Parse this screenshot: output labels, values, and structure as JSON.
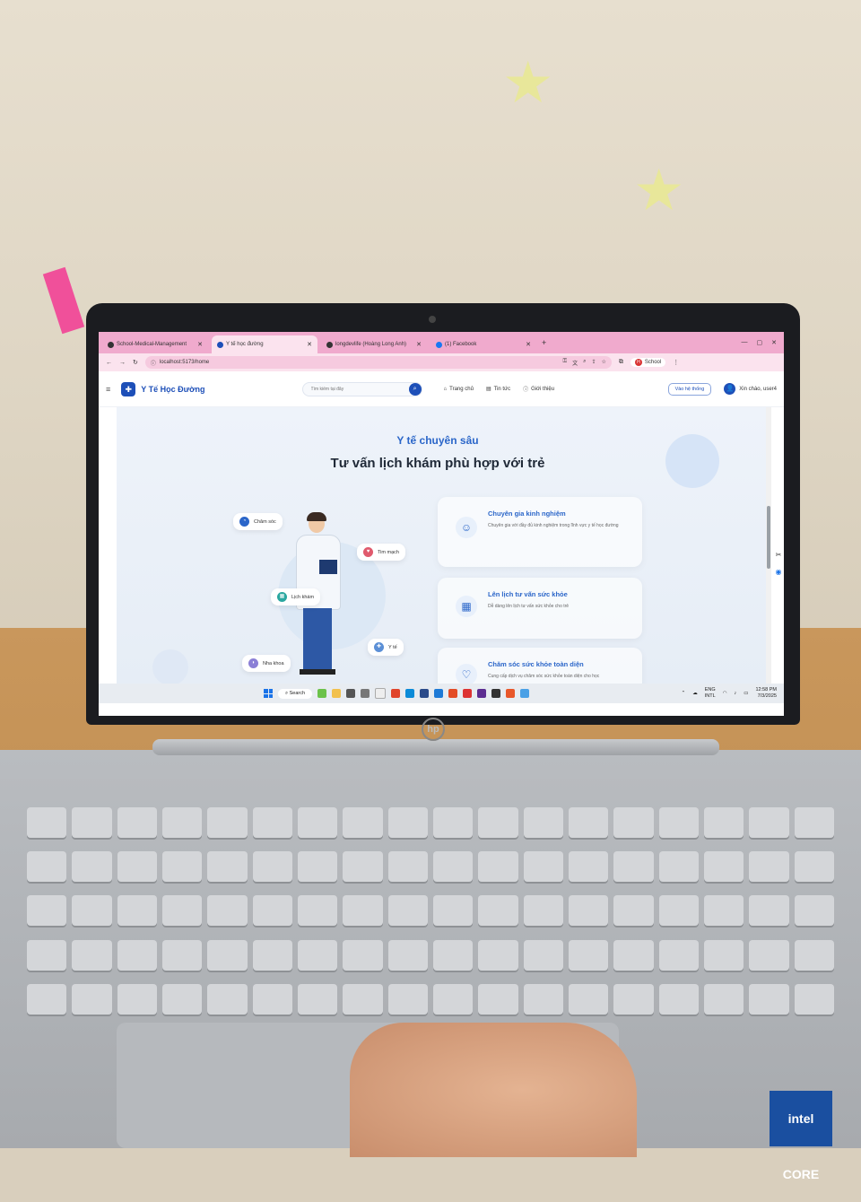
{
  "browser": {
    "tabs": [
      {
        "label": "School-Medical-Management",
        "icon": "github-icon",
        "active": false
      },
      {
        "label": "Y tế học đường",
        "icon": "site-icon",
        "active": true
      },
      {
        "label": "longdevlife (Hoàng Long Anh)",
        "icon": "github-icon",
        "active": false
      },
      {
        "label": "(1) Facebook",
        "icon": "facebook-icon",
        "active": false
      }
    ],
    "new_tab": "+",
    "url": "localhost:5173/home",
    "profile_initial": "H",
    "profile_label": "School"
  },
  "site": {
    "brand": "Y Tế Học Đường",
    "search_placeholder": "Tìm kiếm tại đây",
    "nav": [
      "Trang chủ",
      "Tin tức",
      "Giới thiệu"
    ],
    "system_button": "Vào hệ thống",
    "greeting": "Xin chào, user4"
  },
  "hero": {
    "kicker": "Y tế chuyên sâu",
    "headline": "Tư vấn lịch khám phù hợp với trẻ",
    "chips": [
      "Chăm sóc",
      "Tim mạch",
      "Lịch khám",
      "Y tế",
      "Nha khoa"
    ],
    "features": [
      {
        "title": "Chuyên gia kinh nghiệm",
        "desc": "Chuyên gia với đầy đủ kinh nghiệm trong lĩnh vực y tế học đường",
        "icon": "user-icon"
      },
      {
        "title": "Lên lịch tư vấn sức khỏe",
        "desc": "Dễ dàng lên lịch tư vấn sức khỏe cho trẻ",
        "icon": "calendar-icon"
      },
      {
        "title": "Chăm sóc sức khỏe toàn diện",
        "desc": "Cung cấp dịch vụ chăm sóc sức khỏe toàn diện cho học",
        "icon": "heart-icon"
      }
    ]
  },
  "taskbar": {
    "search": "Search",
    "lang_top": "ENG",
    "lang_bottom": "INTL",
    "time": "12:58 PM",
    "date": "7/3/2025"
  },
  "laptop": {
    "brand": "hp",
    "sticker": "intel CORE"
  }
}
